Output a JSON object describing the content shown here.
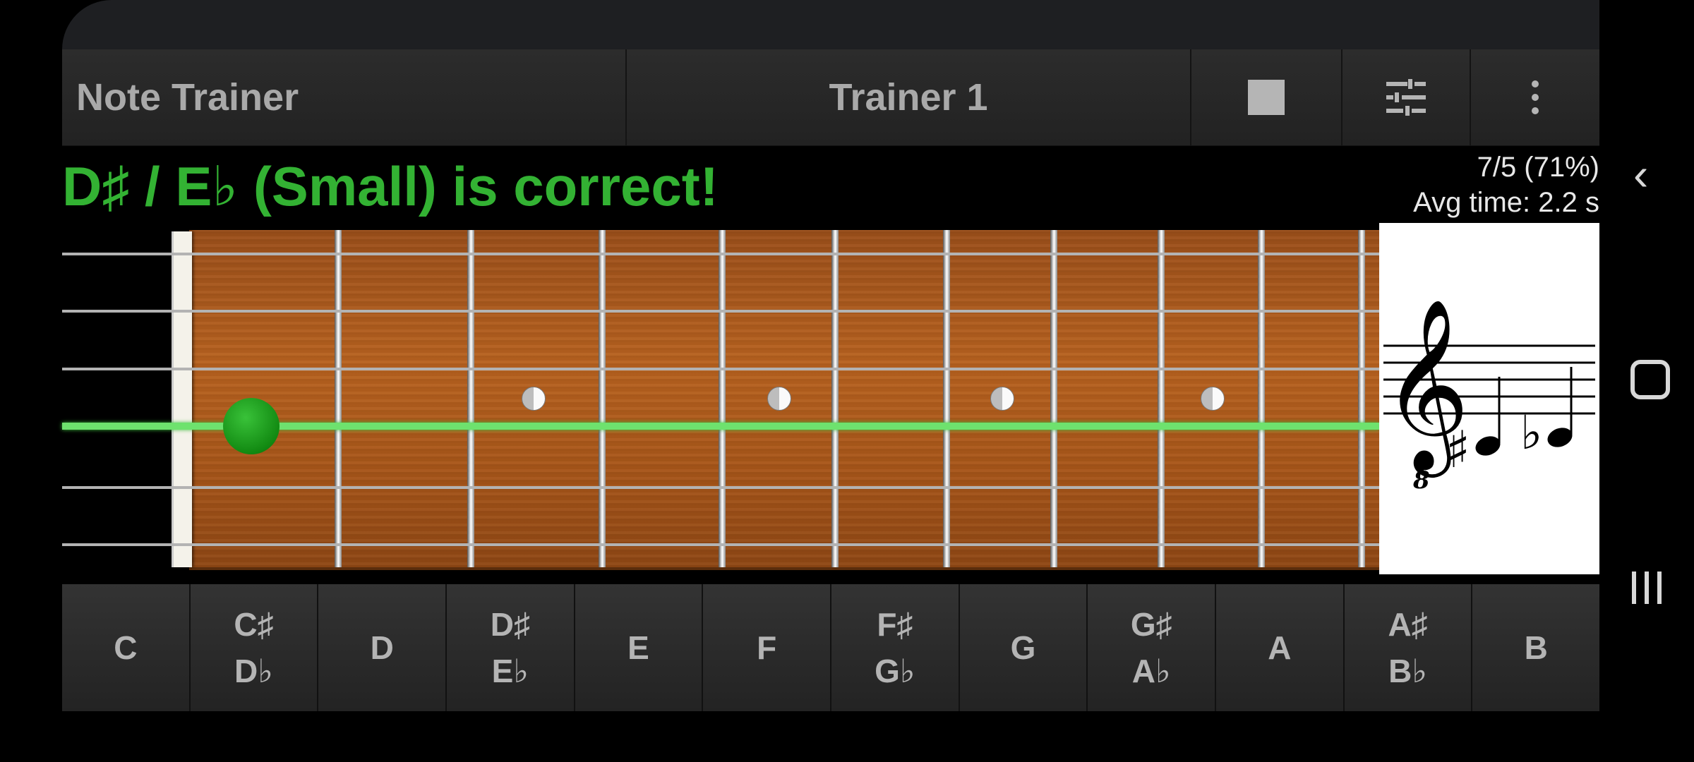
{
  "toolbar": {
    "app_title": "Note Trainer",
    "trainer_name": "Trainer 1",
    "icons": [
      "stop-icon",
      "tune-settings-icon",
      "more-vert-icon"
    ]
  },
  "feedback": {
    "message": "D♯ / E♭ (Small) is correct!",
    "score": "7/5 (71%)",
    "avg_time": "Avg time: 2.2 s"
  },
  "fretboard": {
    "strings": 6,
    "active_string_index": 3,
    "marker_fret": 1,
    "inlay_frets": [
      3,
      5,
      7,
      9
    ],
    "colors": {
      "correct": "#33b233",
      "active_string": "#6ee26e"
    }
  },
  "staff": {
    "clef": "treble-8vb",
    "notes": [
      "D♯",
      "E♭"
    ]
  },
  "notes": [
    {
      "top": "C",
      "bottom": ""
    },
    {
      "top": "C♯",
      "bottom": "D♭"
    },
    {
      "top": "D",
      "bottom": ""
    },
    {
      "top": "D♯",
      "bottom": "E♭"
    },
    {
      "top": "E",
      "bottom": ""
    },
    {
      "top": "F",
      "bottom": ""
    },
    {
      "top": "F♯",
      "bottom": "G♭"
    },
    {
      "top": "G",
      "bottom": ""
    },
    {
      "top": "G♯",
      "bottom": "A♭"
    },
    {
      "top": "A",
      "bottom": ""
    },
    {
      "top": "A♯",
      "bottom": "B♭"
    },
    {
      "top": "B",
      "bottom": ""
    }
  ]
}
